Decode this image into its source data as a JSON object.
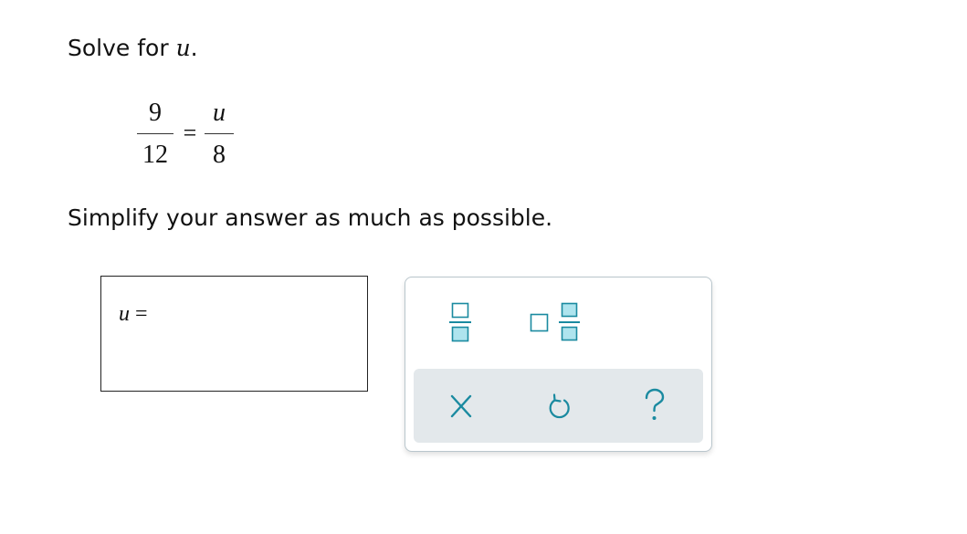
{
  "problem": {
    "prompt_text": "Solve for ",
    "prompt_variable": "u",
    "prompt_end": ".",
    "equation": {
      "left_numerator": "9",
      "left_denominator": "12",
      "operator": "=",
      "right_numerator": "u",
      "right_denominator": "8"
    },
    "instruction": "Simplify your answer as much as possible."
  },
  "answer": {
    "variable": "u",
    "operator": "=",
    "value": ""
  },
  "keypad": {
    "tools": [
      {
        "name": "fraction",
        "icon": "fraction-template-icon"
      },
      {
        "name": "mixed-number",
        "icon": "mixed-number-template-icon"
      }
    ],
    "actions": [
      {
        "name": "clear",
        "icon": "close-icon"
      },
      {
        "name": "undo",
        "icon": "undo-icon"
      },
      {
        "name": "help",
        "icon": "question-icon"
      }
    ],
    "colors": {
      "accent": "#1a8aa0",
      "placeholder_fill": "#aee4ee",
      "action_bar_bg": "#e3e8eb",
      "border": "#b9c6cc"
    }
  }
}
